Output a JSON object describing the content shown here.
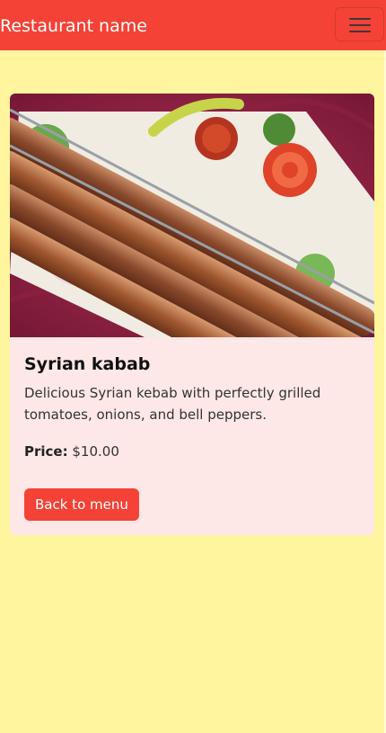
{
  "navbar": {
    "brand": "Restaurant name",
    "toggle_icon": "hamburger-menu-icon"
  },
  "dish": {
    "image_alt": "Syrian kabab",
    "title": "Syrian kabab",
    "description": "Delicious Syrian kebab with perfectly grilled tomatoes, onions, and bell peppers.",
    "price_label": "Price:",
    "price_value": "$10.00"
  },
  "actions": {
    "back_label": "Back to menu"
  },
  "colors": {
    "page_background": "#fff59e",
    "navbar": "#f44236",
    "card_background": "#fde7e7",
    "button": "#f44236"
  }
}
